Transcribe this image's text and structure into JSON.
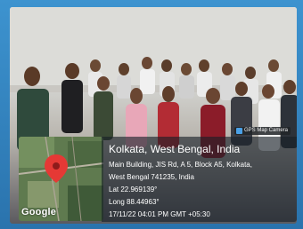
{
  "geotag": {
    "location_title": "Kolkata, West Bengal, India",
    "address_line_1": "Main Building, JIS Rd, A 5, Block A5, Kolkata,",
    "address_line_2": "West Bengal 741235, India",
    "latitude": "Lat 22.969139°",
    "longitude": "Long 88.44963°",
    "datetime": "17/11/22 04:01 PM GMT +05:30",
    "map_brand": "Google",
    "app_tag": "GPS Map Camera"
  },
  "colors": {
    "frame_blue": "#2f7fb8",
    "map_pin": "#e53935",
    "overlay_bg": "rgba(22, 30, 38, 0.62)"
  }
}
